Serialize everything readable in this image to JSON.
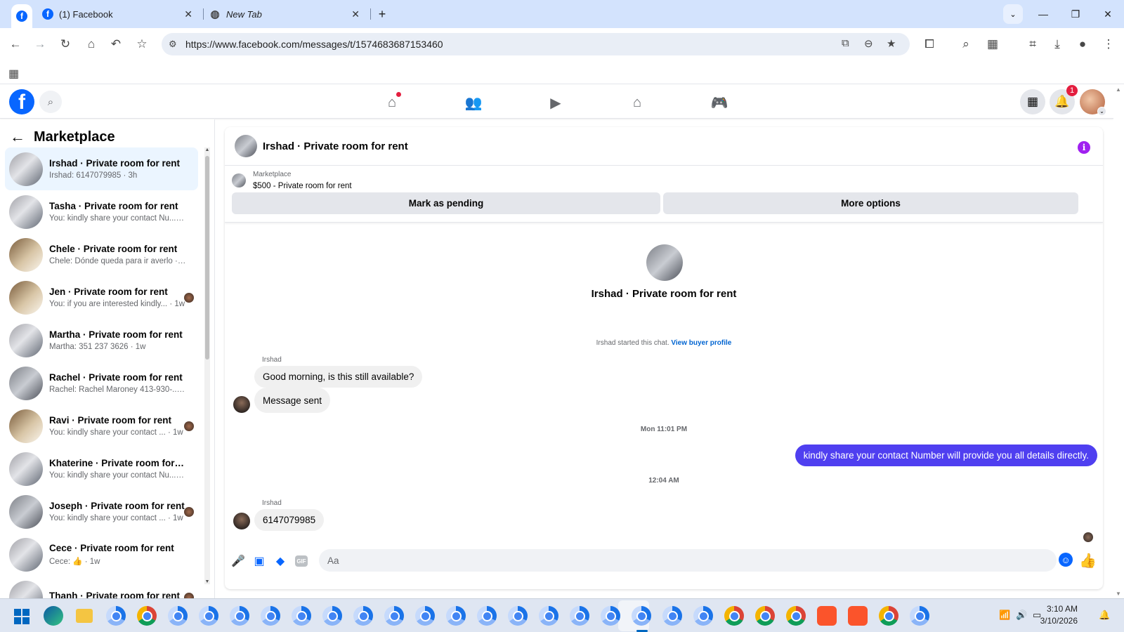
{
  "browser": {
    "tabs": [
      {
        "title": "(1) Facebook",
        "icon": "facebook-icon"
      },
      {
        "title": "New Tab",
        "icon": "globe-icon"
      }
    ],
    "url": "https://www.facebook.com/messages/t/1574683687153460",
    "new_tab_glyph": "+",
    "close_glyph": "✕"
  },
  "sidebar": {
    "title": "Marketplace",
    "conversations": [
      {
        "name": "Irshad · Private room for rent",
        "snippet": "Irshad: 6147079985 · 3h",
        "selected": true
      },
      {
        "name": "Tasha · Private room for rent",
        "snippet": "You: kindly share your contact Nu... · 2d"
      },
      {
        "name": "Chele · Private room for rent",
        "snippet": "Chele: Dónde queda para ir averlo · 6d"
      },
      {
        "name": "Jen · Private room for rent",
        "snippet": "You: if you are interested kindly... · 1w"
      },
      {
        "name": "Martha · Private room for rent",
        "snippet": "Martha: 351 237 3626 · 1w"
      },
      {
        "name": "Rachel · Private room for rent",
        "snippet": "Rachel: Rachel Maroney 413-930-... · 1w"
      },
      {
        "name": "Ravi · Private room for rent",
        "snippet": "You: kindly share your contact ... · 1w"
      },
      {
        "name": "Khaterine · Private room for rent",
        "snippet": "You: kindly share your contact Nu... · 1w"
      },
      {
        "name": "Joseph · Private room for rent",
        "snippet": "You: kindly share your contact ... · 1w"
      },
      {
        "name": "Cece · Private room for rent",
        "snippet": "Cece: 👍 · 1w"
      },
      {
        "name": "Thanh · Private room for rent",
        "snippet": ""
      }
    ]
  },
  "header": {
    "notifications_count": "1"
  },
  "chat": {
    "title": "Irshad · Private room for rent",
    "marketplace_label": "Marketplace",
    "listing": "$500 - Private room for rent",
    "mark_pending": "Mark as pending",
    "more_options": "More options",
    "center_name": "Irshad · Private room for rent",
    "started_text": "Irshad started this chat.",
    "view_profile": "View buyer profile",
    "messages": {
      "sender1": "Irshad",
      "m1": "Good morning, is this still available?",
      "m2": "Message sent",
      "ts1": "Mon 11:01 PM",
      "out1": "kindly share your contact Number will provide you all details directly.",
      "ts2": "12:04 AM",
      "sender2": "Irshad",
      "m3": "6147079985"
    },
    "composer_placeholder": "Aa"
  },
  "taskbar": {
    "time": "3:10 AM",
    "date": "3/10/2026"
  }
}
